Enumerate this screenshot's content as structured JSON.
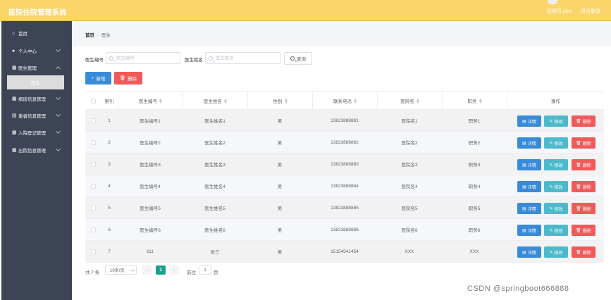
{
  "header": {
    "app_title": "医院住院管理系统",
    "user_label": "管理员 abo",
    "logout_label": "退出登录"
  },
  "sidebar": {
    "items": [
      {
        "label": "首页",
        "icon": "home-icon",
        "glyph": "⌂"
      },
      {
        "label": "个人中心",
        "icon": "user-icon",
        "glyph": "●"
      },
      {
        "label": "医生管理",
        "icon": "grid-icon",
        "glyph": "▦"
      },
      {
        "label": "病房信息管理",
        "icon": "grid-icon",
        "glyph": "▦"
      },
      {
        "label": "患者信息管理",
        "icon": "document-icon",
        "glyph": "▤"
      },
      {
        "label": "入院登记管理",
        "icon": "grid-icon",
        "glyph": "▦"
      },
      {
        "label": "出院信息管理",
        "icon": "grid-icon",
        "glyph": "▦"
      }
    ],
    "sub_item": {
      "label": "医生"
    }
  },
  "breadcrumb": {
    "home": "首页",
    "separator": "/",
    "current": "医生"
  },
  "search": {
    "doctor_no_label": "医生编号",
    "doctor_no_placeholder": "医生编号",
    "doctor_name_label": "医生姓名",
    "doctor_name_placeholder": "医生姓名",
    "query_label": "查询"
  },
  "actions": {
    "add_label": "新增",
    "delete_label": "删除"
  },
  "table": {
    "columns": [
      "索引",
      "医生编号",
      "医生姓名",
      "性别",
      "联系电话",
      "医院名",
      "职务",
      "操作"
    ],
    "op_labels": {
      "detail": "详情",
      "edit": "修改",
      "delete": "删除"
    },
    "rows": [
      {
        "index": "1",
        "doctor_no": "医生编号1",
        "doctor_name": "医生姓名1",
        "gender": "男",
        "phone": "13823888881",
        "hospital": "医院名1",
        "title": "职务1"
      },
      {
        "index": "2",
        "doctor_no": "医生编号2",
        "doctor_name": "医生姓名2",
        "gender": "男",
        "phone": "13823888882",
        "hospital": "医院名2",
        "title": "职务2"
      },
      {
        "index": "3",
        "doctor_no": "医生编号3",
        "doctor_name": "医生姓名3",
        "gender": "男",
        "phone": "13823888883",
        "hospital": "医院名3",
        "title": "职务3"
      },
      {
        "index": "4",
        "doctor_no": "医生编号4",
        "doctor_name": "医生姓名4",
        "gender": "男",
        "phone": "13823888884",
        "hospital": "医院名4",
        "title": "职务4"
      },
      {
        "index": "5",
        "doctor_no": "医生编号5",
        "doctor_name": "医生姓名5",
        "gender": "男",
        "phone": "13823888885",
        "hospital": "医院名5",
        "title": "职务5"
      },
      {
        "index": "6",
        "doctor_no": "医生编号6",
        "doctor_name": "医生姓名6",
        "gender": "男",
        "phone": "13823888886",
        "hospital": "医院名6",
        "title": "职务6"
      },
      {
        "index": "7",
        "doctor_no": "111",
        "doctor_name": "张三",
        "gender": "男",
        "phone": "15154541454",
        "hospital": "XXX",
        "title": "XXX"
      }
    ]
  },
  "pagination": {
    "total_label": "共 7 条",
    "page_size_label": "10条/页",
    "prev_glyph": "‹",
    "current_page": "1",
    "next_glyph": "›",
    "goto_label": "前往",
    "goto_value": "1",
    "page_unit": "页"
  },
  "watermark": "CSDN @springboot666888",
  "colors": {
    "header_bg": "#fbd46a",
    "sidebar_bg": "#3d4456",
    "primary": "#3a8bd7",
    "info": "#4fb9cc",
    "danger": "#f05a5a",
    "pager_active": "#19a08e"
  }
}
